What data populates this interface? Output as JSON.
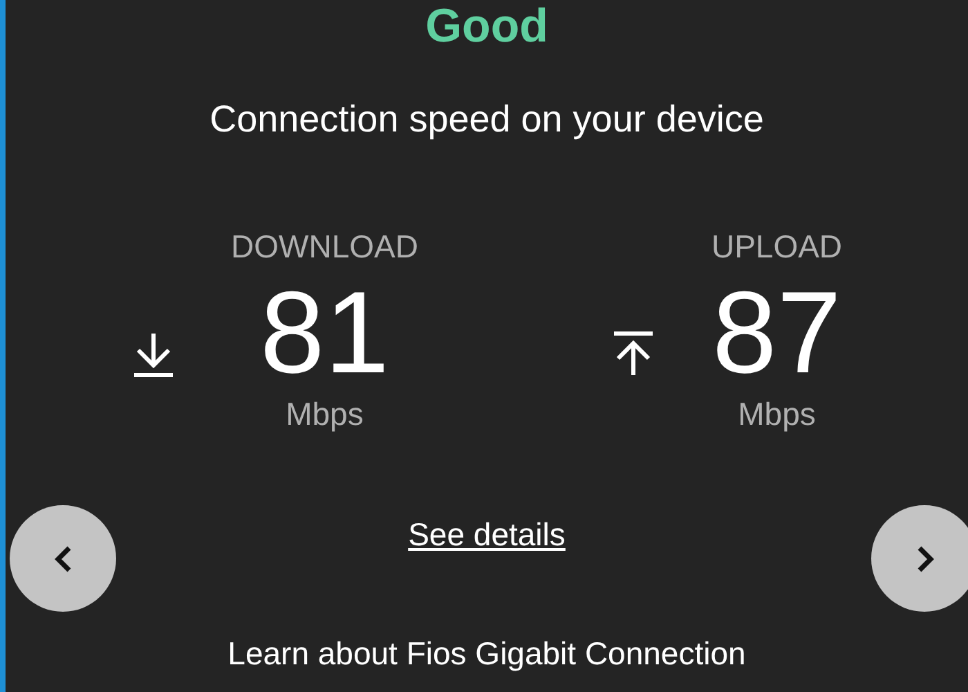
{
  "rating": "Good",
  "subtitle": "Connection speed on your device",
  "speeds": [
    {
      "kind": "download",
      "label": "DOWNLOAD",
      "value": "81",
      "unit": "Mbps"
    },
    {
      "kind": "upload",
      "label": "UPLOAD",
      "value": "87",
      "unit": "Mbps"
    }
  ],
  "details_link": "See details",
  "footer_link": "Learn about Fios Gigabit Connection"
}
